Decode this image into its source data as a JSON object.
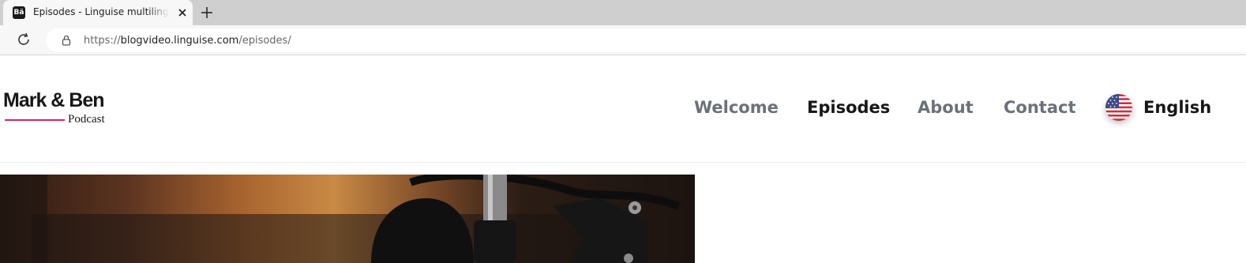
{
  "browser": {
    "tab": {
      "favicon_text": "Bä",
      "title": "Episodes - Linguise multilingual demo"
    },
    "url": {
      "scheme": "https://",
      "host": "blogvideo.linguise.com",
      "path": "/episodes/"
    }
  },
  "site": {
    "logo": {
      "main": "Mark & Ben",
      "sub": "Podcast",
      "accent_color": "#d4245e"
    },
    "nav": [
      {
        "label": "Welcome",
        "active": false
      },
      {
        "label": "Episodes",
        "active": true
      },
      {
        "label": "About",
        "active": false
      },
      {
        "label": "Contact",
        "active": false
      }
    ],
    "language": {
      "label": "English",
      "flag_icon": "us-flag-icon"
    }
  },
  "colors": {
    "nav_inactive": "#6a7178",
    "nav_active": "#171717"
  }
}
